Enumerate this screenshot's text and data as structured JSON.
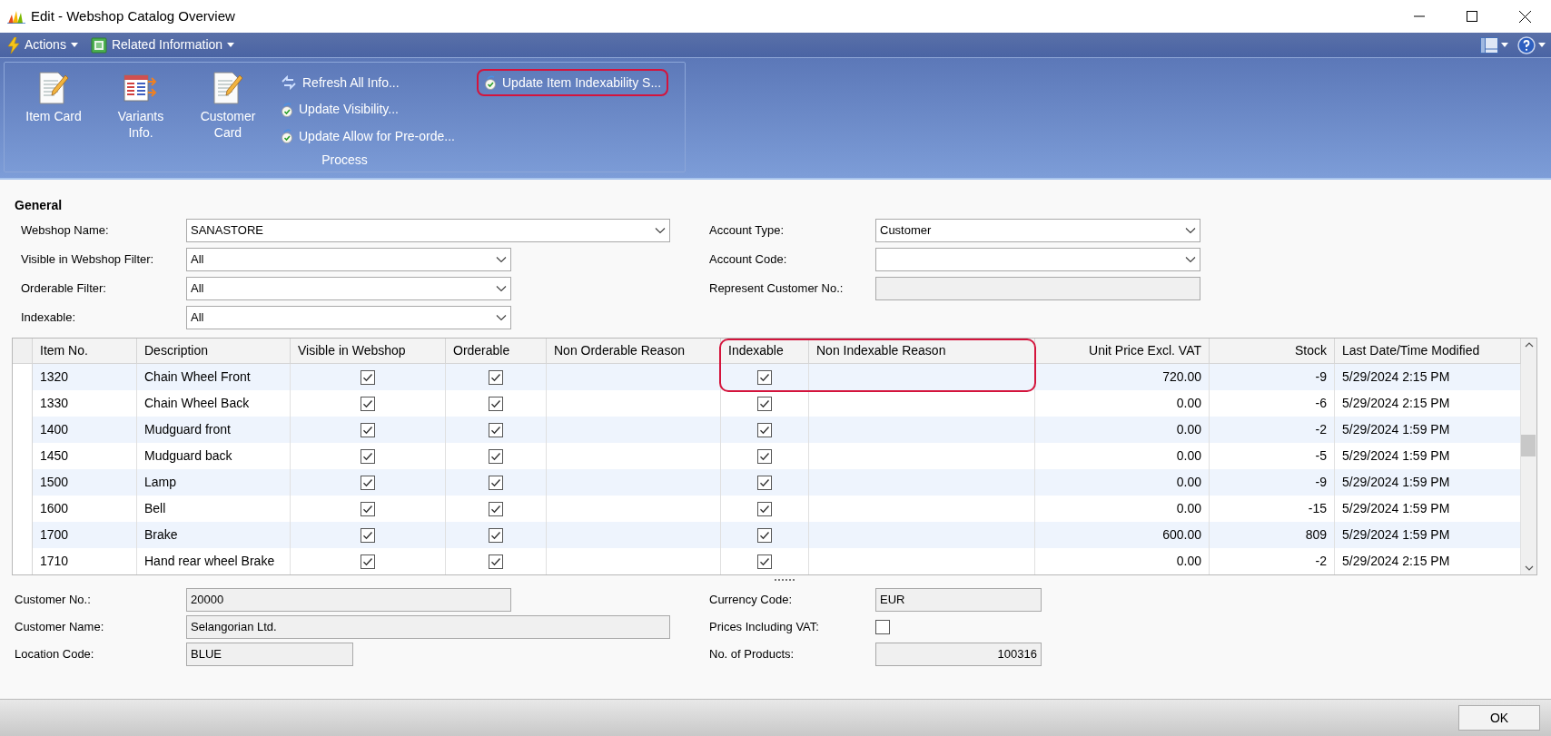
{
  "window": {
    "title": "Edit - Webshop Catalog Overview"
  },
  "menu": [
    {
      "label": "Actions",
      "kind": "actions"
    },
    {
      "label": "Related Information",
      "kind": "related"
    }
  ],
  "ribbon": {
    "large_actions": [
      {
        "label": "Item Card",
        "kind": "card"
      },
      {
        "label": "Variants Info.",
        "kind": "variants"
      },
      {
        "label": "Customer Card",
        "kind": "card"
      }
    ],
    "small_actions": [
      {
        "label": "Refresh All Info...",
        "kind": "refresh",
        "highlighted": false
      },
      {
        "label": "Update Visibility...",
        "kind": "update",
        "highlighted": false
      },
      {
        "label": "Update Allow for Pre-orde...",
        "kind": "update",
        "highlighted": false
      },
      {
        "label": "Update Item Indexability S...",
        "kind": "update",
        "highlighted": true
      }
    ],
    "group": "Process"
  },
  "general": {
    "title": "General",
    "left_fields": [
      {
        "label": "Webshop Name:",
        "value": "SANASTORE",
        "kind": "dropdown"
      },
      {
        "label": "Visible in Webshop Filter:",
        "value": "All",
        "kind": "dropdown"
      },
      {
        "label": "Orderable Filter:",
        "value": "All",
        "kind": "dropdown"
      },
      {
        "label": "Indexable:",
        "value": "All",
        "kind": "dropdown"
      }
    ],
    "right_fields": [
      {
        "label": "Account Type:",
        "value": "Customer",
        "kind": "dropdown"
      },
      {
        "label": "Account Code:",
        "kind": "dropdown"
      },
      {
        "label": "Represent Customer No.:",
        "kind": "readonly"
      }
    ]
  },
  "table": {
    "columns": [
      {
        "label": "Item No.",
        "kind": "text",
        "highlighted": false
      },
      {
        "label": "Description",
        "kind": "text",
        "highlighted": false
      },
      {
        "label": "Visible in Webshop",
        "kind": "check",
        "highlighted": false
      },
      {
        "label": "Orderable",
        "kind": "check",
        "highlighted": false
      },
      {
        "label": "Non Orderable Reason",
        "kind": "text",
        "highlighted": false
      },
      {
        "label": "Indexable",
        "kind": "check",
        "highlighted": true
      },
      {
        "label": "Non Indexable Reason",
        "kind": "text",
        "highlighted": true
      },
      {
        "label": "Unit Price Excl. VAT",
        "kind": "number",
        "highlighted": false
      },
      {
        "label": "Stock",
        "kind": "number",
        "highlighted": false
      },
      {
        "label": "Last Date/Time Modified",
        "kind": "text",
        "highlighted": false
      }
    ],
    "rows": [
      {
        "item_no": "1320",
        "description": "Chain Wheel Front",
        "visible": true,
        "orderable": true,
        "indexable": true,
        "unit_price": "720.00",
        "stock": "-9",
        "modified": "5/29/2024 2:15 PM"
      },
      {
        "item_no": "1330",
        "description": "Chain Wheel Back",
        "visible": true,
        "orderable": true,
        "indexable": true,
        "unit_price": "0.00",
        "stock": "-6",
        "modified": "5/29/2024 2:15 PM"
      },
      {
        "item_no": "1400",
        "description": "Mudguard front",
        "visible": true,
        "orderable": true,
        "indexable": true,
        "unit_price": "0.00",
        "stock": "-2",
        "modified": "5/29/2024 1:59 PM"
      },
      {
        "item_no": "1450",
        "description": "Mudguard back",
        "visible": true,
        "orderable": true,
        "indexable": true,
        "unit_price": "0.00",
        "stock": "-5",
        "modified": "5/29/2024 1:59 PM"
      },
      {
        "item_no": "1500",
        "description": "Lamp",
        "visible": true,
        "orderable": true,
        "indexable": true,
        "unit_price": "0.00",
        "stock": "-9",
        "modified": "5/29/2024 1:59 PM"
      },
      {
        "item_no": "1600",
        "description": "Bell",
        "visible": true,
        "orderable": true,
        "indexable": true,
        "unit_price": "0.00",
        "stock": "-15",
        "modified": "5/29/2024 1:59 PM"
      },
      {
        "item_no": "1700",
        "description": "Brake",
        "visible": true,
        "orderable": true,
        "indexable": true,
        "unit_price": "600.00",
        "stock": "809",
        "modified": "5/29/2024 1:59 PM"
      },
      {
        "item_no": "1710",
        "description": "Hand rear wheel Brake",
        "visible": true,
        "orderable": true,
        "indexable": true,
        "unit_price": "0.00",
        "stock": "-2",
        "modified": "5/29/2024 2:15 PM"
      }
    ]
  },
  "details": {
    "left_fields": [
      {
        "label": "Customer No.:",
        "value": "20000",
        "kind": "readonly"
      },
      {
        "label": "Customer Name:",
        "value": "Selangorian Ltd.",
        "kind": "readonly"
      },
      {
        "label": "Location Code:",
        "value": "BLUE",
        "kind": "readonly"
      }
    ],
    "right_fields": [
      {
        "label": "Currency Code:",
        "value": "EUR",
        "kind": "readonly"
      },
      {
        "label": "Prices Including VAT:",
        "kind": "checkbox",
        "checked": false
      },
      {
        "label": "No. of Products:",
        "value": "100316",
        "kind": "readonly_number"
      }
    ]
  },
  "footer": {
    "button": "OK"
  }
}
